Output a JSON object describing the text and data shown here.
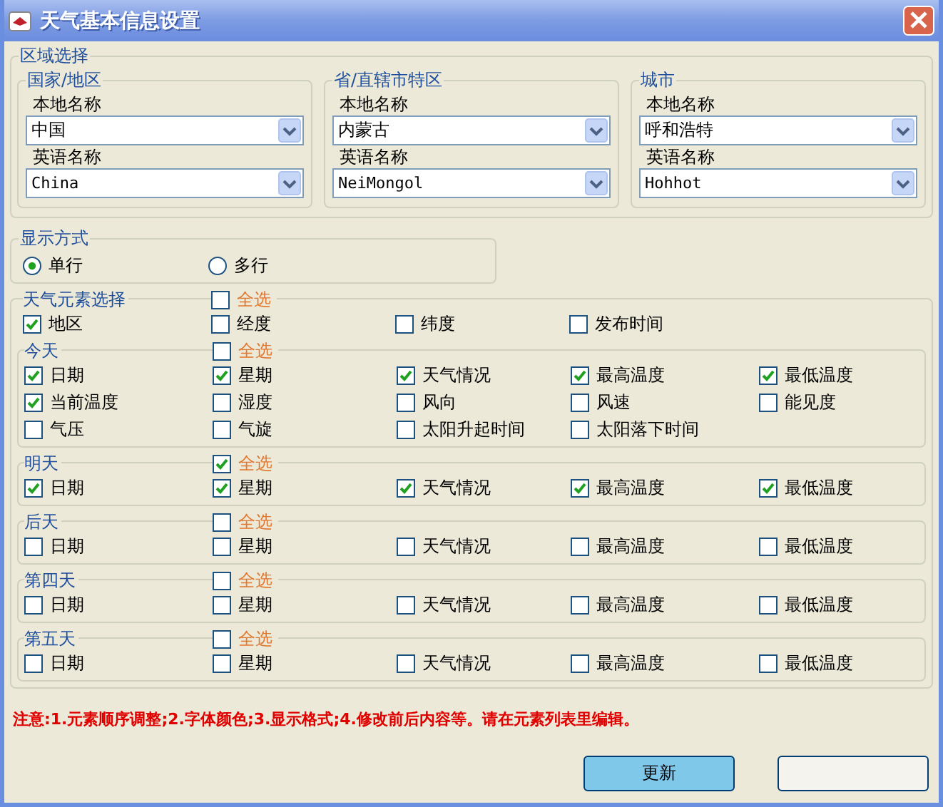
{
  "window": {
    "title": "天气基本信息设置"
  },
  "region": {
    "title": "区域选择",
    "groups": [
      {
        "title": "国家/地区",
        "fields": [
          {
            "label": "本地名称",
            "value": "中国"
          },
          {
            "label": "英语名称",
            "value": "China"
          }
        ]
      },
      {
        "title": "省/直辖市特区",
        "fields": [
          {
            "label": "本地名称",
            "value": "内蒙古"
          },
          {
            "label": "英语名称",
            "value": "NeiMongol"
          }
        ]
      },
      {
        "title": "城市",
        "fields": [
          {
            "label": "本地名称",
            "value": "呼和浩特"
          },
          {
            "label": "英语名称",
            "value": "Hohhot"
          }
        ]
      }
    ]
  },
  "display": {
    "title": "显示方式",
    "options": [
      {
        "label": "单行",
        "selected": true
      },
      {
        "label": "多行",
        "selected": false
      }
    ]
  },
  "elements": {
    "title": "天气元素选择",
    "select_all": {
      "label": "全选",
      "checked": false
    },
    "items": [
      {
        "label": "地区",
        "checked": true
      },
      {
        "label": "经度",
        "checked": false
      },
      {
        "label": "纬度",
        "checked": false
      },
      {
        "label": "发布时间",
        "checked": false
      }
    ],
    "sections": [
      {
        "title": "今天",
        "select_all": {
          "label": "全选",
          "checked": false
        },
        "items": [
          {
            "label": "日期",
            "checked": true
          },
          {
            "label": "星期",
            "checked": true
          },
          {
            "label": "天气情况",
            "checked": true
          },
          {
            "label": "最高温度",
            "checked": true
          },
          {
            "label": "最低温度",
            "checked": true
          },
          {
            "label": "当前温度",
            "checked": true
          },
          {
            "label": "湿度",
            "checked": false
          },
          {
            "label": "风向",
            "checked": false
          },
          {
            "label": "风速",
            "checked": false
          },
          {
            "label": "能见度",
            "checked": false
          },
          {
            "label": "气压",
            "checked": false
          },
          {
            "label": "气旋",
            "checked": false
          },
          {
            "label": "太阳升起时间",
            "checked": false
          },
          {
            "label": "太阳落下时间",
            "checked": false
          }
        ]
      },
      {
        "title": "明天",
        "select_all": {
          "label": "全选",
          "checked": true
        },
        "items": [
          {
            "label": "日期",
            "checked": true
          },
          {
            "label": "星期",
            "checked": true
          },
          {
            "label": "天气情况",
            "checked": true
          },
          {
            "label": "最高温度",
            "checked": true
          },
          {
            "label": "最低温度",
            "checked": true
          }
        ]
      },
      {
        "title": "后天",
        "select_all": {
          "label": "全选",
          "checked": false
        },
        "items": [
          {
            "label": "日期",
            "checked": false
          },
          {
            "label": "星期",
            "checked": false
          },
          {
            "label": "天气情况",
            "checked": false
          },
          {
            "label": "最高温度",
            "checked": false
          },
          {
            "label": "最低温度",
            "checked": false
          }
        ]
      },
      {
        "title": "第四天",
        "select_all": {
          "label": "全选",
          "checked": false
        },
        "items": [
          {
            "label": "日期",
            "checked": false
          },
          {
            "label": "星期",
            "checked": false
          },
          {
            "label": "天气情况",
            "checked": false
          },
          {
            "label": "最高温度",
            "checked": false
          },
          {
            "label": "最低温度",
            "checked": false
          }
        ]
      },
      {
        "title": "第五天",
        "select_all": {
          "label": "全选",
          "checked": false
        },
        "items": [
          {
            "label": "日期",
            "checked": false
          },
          {
            "label": "星期",
            "checked": false
          },
          {
            "label": "天气情况",
            "checked": false
          },
          {
            "label": "最高温度",
            "checked": false
          },
          {
            "label": "最低温度",
            "checked": false
          }
        ]
      }
    ]
  },
  "note": "注意:1.元素顺序调整;2.字体颜色;3.显示格式;4.修改前后内容等。请在元素列表里编辑。",
  "buttons": [
    {
      "kind": "primary",
      "label": "更新"
    },
    {
      "kind": "blank"
    }
  ]
}
